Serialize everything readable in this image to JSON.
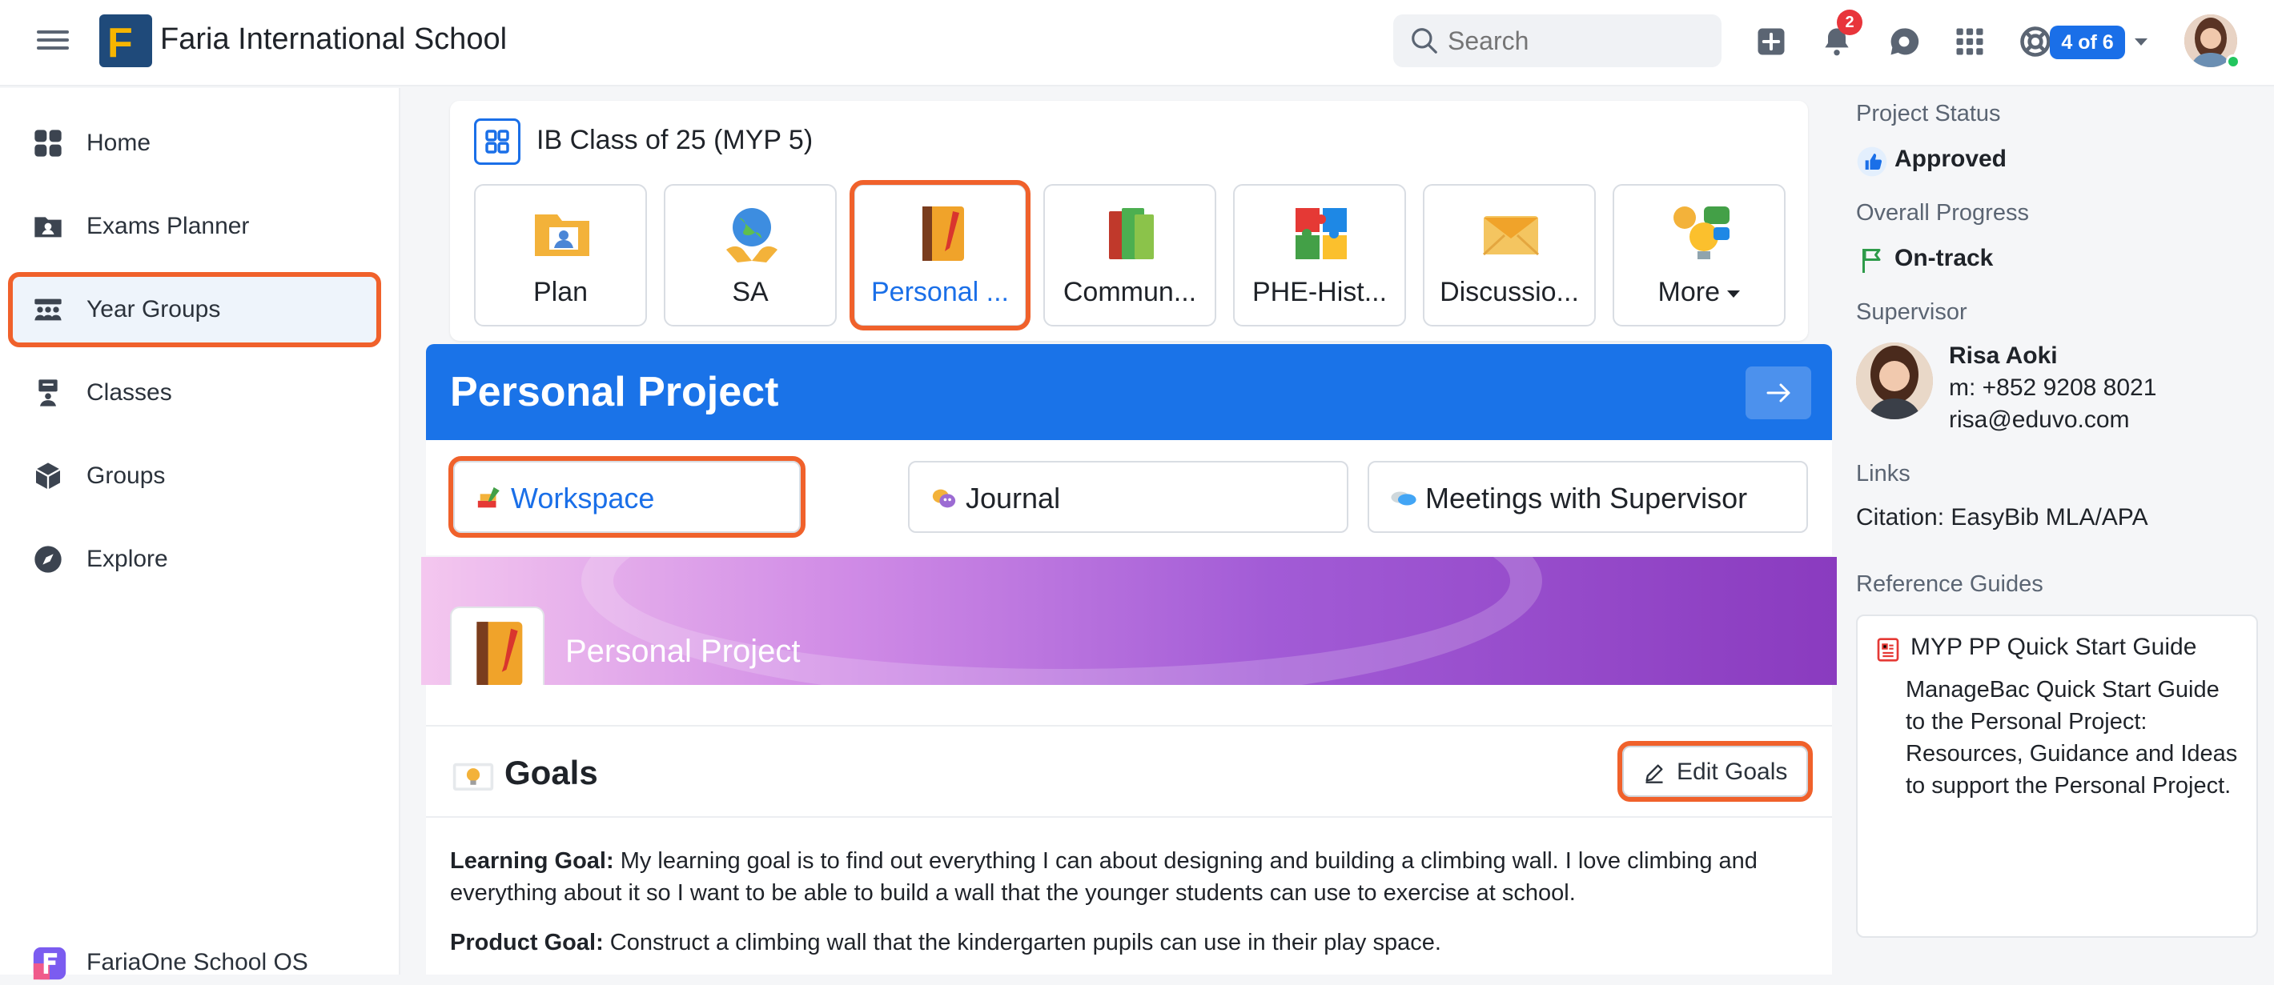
{
  "topbar": {
    "school_name": "Faria International School",
    "logo_letter": "F",
    "search_placeholder": "Search",
    "notification_count": "2",
    "progress_pill": "4 of 6"
  },
  "sidebar": {
    "items": [
      {
        "label": "Home",
        "icon": "grid-icon"
      },
      {
        "label": "Exams Planner",
        "icon": "folder-user-icon"
      },
      {
        "label": "Year Groups",
        "icon": "people-group-icon",
        "active": true
      },
      {
        "label": "Classes",
        "icon": "presenter-icon"
      },
      {
        "label": "Groups",
        "icon": "cube-icon"
      },
      {
        "label": "Explore",
        "icon": "compass-icon"
      }
    ],
    "footer_label": "FariaOne School OS"
  },
  "class_card": {
    "title": "IB Class of 25 (MYP 5)",
    "tiles": [
      {
        "label": "Plan",
        "icon": "plan-folder-icon"
      },
      {
        "label": "SA",
        "icon": "globe-hands-icon"
      },
      {
        "label": "Personal ...",
        "icon": "notebook-icon",
        "active": true
      },
      {
        "label": "Commun...",
        "icon": "books-icon"
      },
      {
        "label": "PHE-Hist...",
        "icon": "puzzle-icon"
      },
      {
        "label": "Discussio...",
        "icon": "envelope-icon"
      },
      {
        "label": "More",
        "icon": "ideas-icon"
      }
    ]
  },
  "project": {
    "title": "Personal Project",
    "tabs": [
      {
        "label": "Workspace",
        "active": true
      },
      {
        "label": "Journal"
      },
      {
        "label": "Meetings with Supervisor"
      }
    ],
    "banner_title": "Personal Project",
    "goals_heading": "Goals",
    "edit_goals_label": "Edit Goals",
    "learning_goal_label": "Learning Goal:",
    "learning_goal_text": " My learning goal is to find out everything I can about designing and building a climbing wall. I love climbing and everything about it so I want to be able to build a wall that the younger students can use to exercise at school.",
    "product_goal_label": "Product Goal:",
    "product_goal_text": " Construct a climbing wall that the kindergarten pupils can use in their play space."
  },
  "right_panel": {
    "status_label": "Project Status",
    "status_value": "Approved",
    "progress_label": "Overall Progress",
    "progress_value": "On-track",
    "supervisor_label": "Supervisor",
    "supervisor_name": "Risa Aoki",
    "supervisor_phone": "m: +852 9208 8021",
    "supervisor_email": "risa@eduvo.com",
    "links_label": "Links",
    "link_text": "Citation: EasyBib MLA/APA",
    "guides_label": "Reference Guides",
    "guide_title": "MYP PP Quick Start Guide",
    "guide_desc": "ManageBac Quick Start Guide to the Personal Project: Resources, Guidance and Ideas to support the Personal Project."
  },
  "colors": {
    "accent": "#1a73e8",
    "highlight": "#f0612b",
    "badge": "#e8353b",
    "online": "#22c55e"
  }
}
